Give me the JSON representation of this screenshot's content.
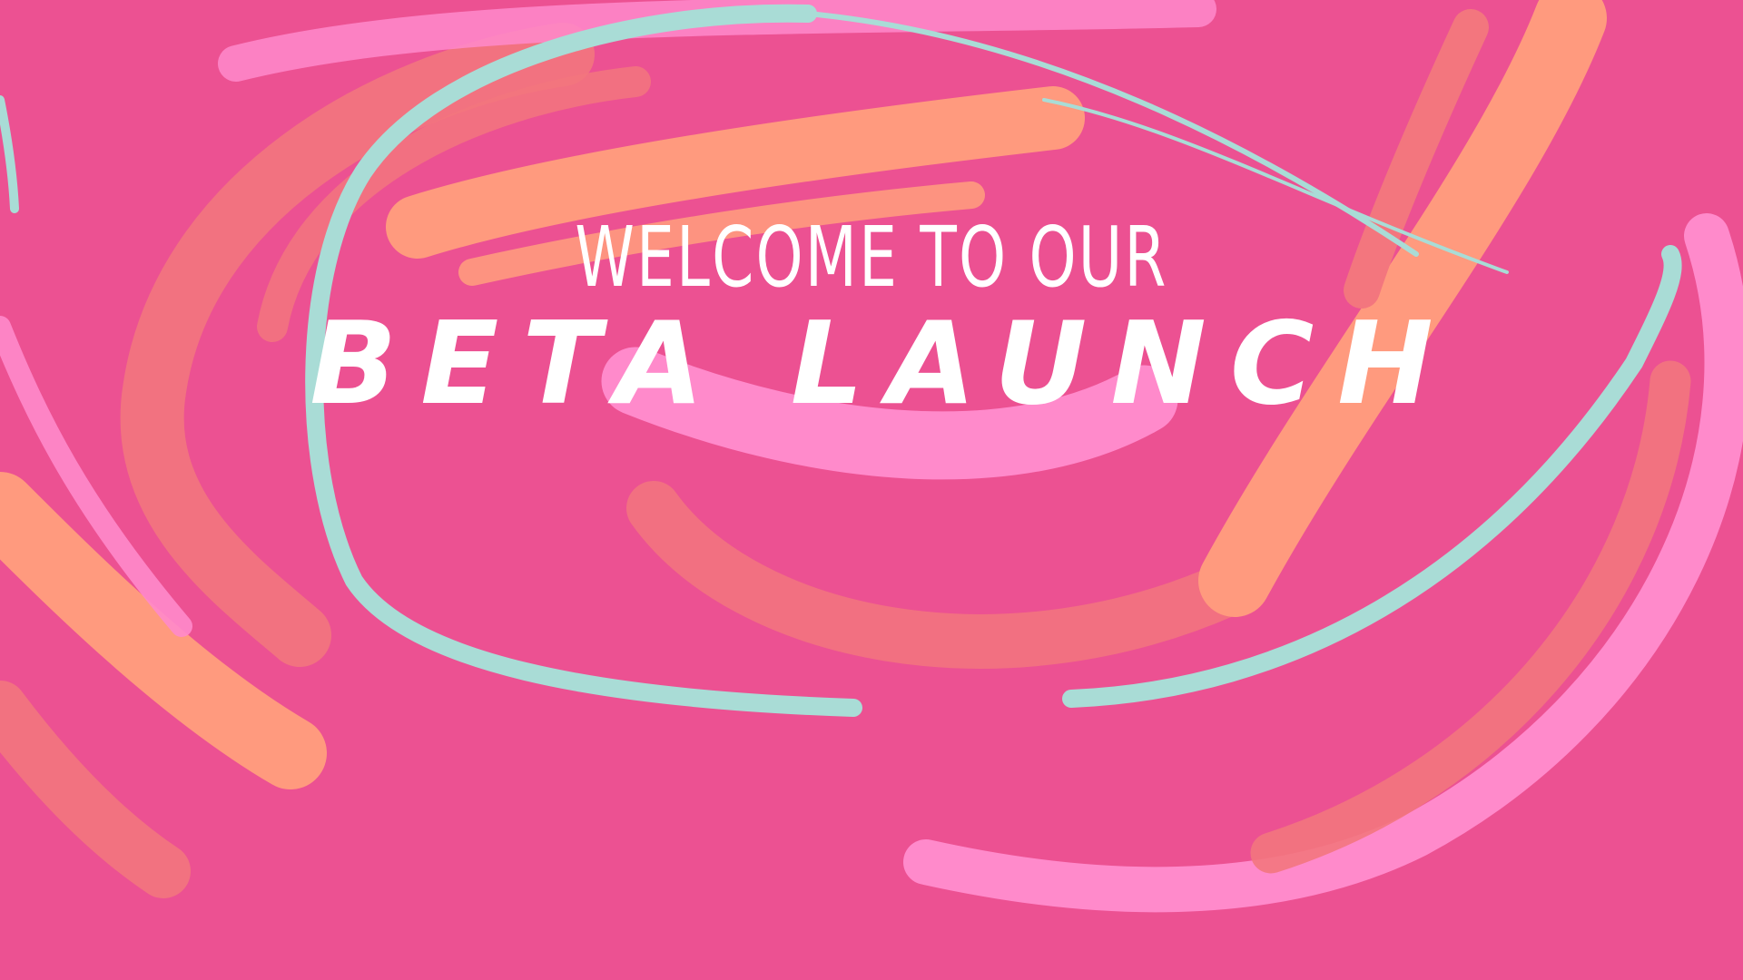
{
  "colors": {
    "background": "#EC5192",
    "teal": "#A9DCD6",
    "peach": "#FF9A7E",
    "coral": "#F3767E",
    "light_pink": "#FF8ACB",
    "text": "#FFFFFF"
  },
  "headline": {
    "line1": "WELCOME TO OUR",
    "line2": "BETA LAUNCH"
  }
}
